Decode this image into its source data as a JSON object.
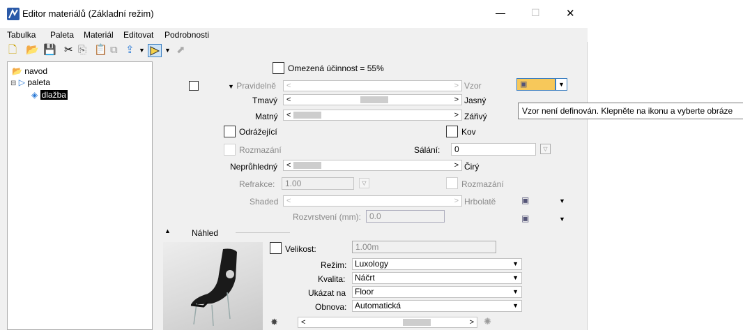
{
  "window": {
    "title": "Editor materiálů (Základní režim)",
    "minimize": "—",
    "maximize": "☐",
    "close": "✕"
  },
  "menu": [
    "Tabulka",
    "Paleta",
    "Materiál",
    "Editovat",
    "Podrobnosti"
  ],
  "tree": {
    "root": "navod",
    "palette": "paleta",
    "material": "dlažba"
  },
  "efficiency": "Omezená účinnost = 55%",
  "pattern": {
    "left": "Pravidelně",
    "right": "Vzor",
    "tooltip": "Vzor není definován. Klepněte na ikonu a vyberte obráze"
  },
  "sliders": {
    "dark": {
      "left": "Tmavý",
      "right": "Jasný"
    },
    "matte": {
      "left": "Matný",
      "right": "Zářivý"
    },
    "opaque": {
      "left": "Neprůhledný",
      "right": "Čirý"
    },
    "shaded": {
      "left": "Shaded",
      "right": "Hrbolatě"
    }
  },
  "reflective": "Odrážející",
  "metal": "Kov",
  "blur": "Rozmazání",
  "glow": {
    "label": "Sálání:",
    "value": "0"
  },
  "refraction": {
    "label": "Refrakce:",
    "value": "1.00"
  },
  "blur2": "Rozmazání",
  "layering": {
    "label": "Rozvrstvení (mm):",
    "value": "0.0"
  },
  "preview": {
    "header": "Náhled",
    "size": {
      "label": "Velikost:",
      "value": "1.00m"
    },
    "mode": {
      "label": "Režim:",
      "value": "Luxology"
    },
    "quality": {
      "label": "Kvalita:",
      "value": "Náčrt"
    },
    "show_on": {
      "label": "Ukázat na",
      "value": "Floor"
    },
    "refresh": {
      "label": "Obnova:",
      "value": "Automatická"
    }
  },
  "colors": {
    "pattern_button": "#f7c85a",
    "selected_bg": "#000000"
  }
}
